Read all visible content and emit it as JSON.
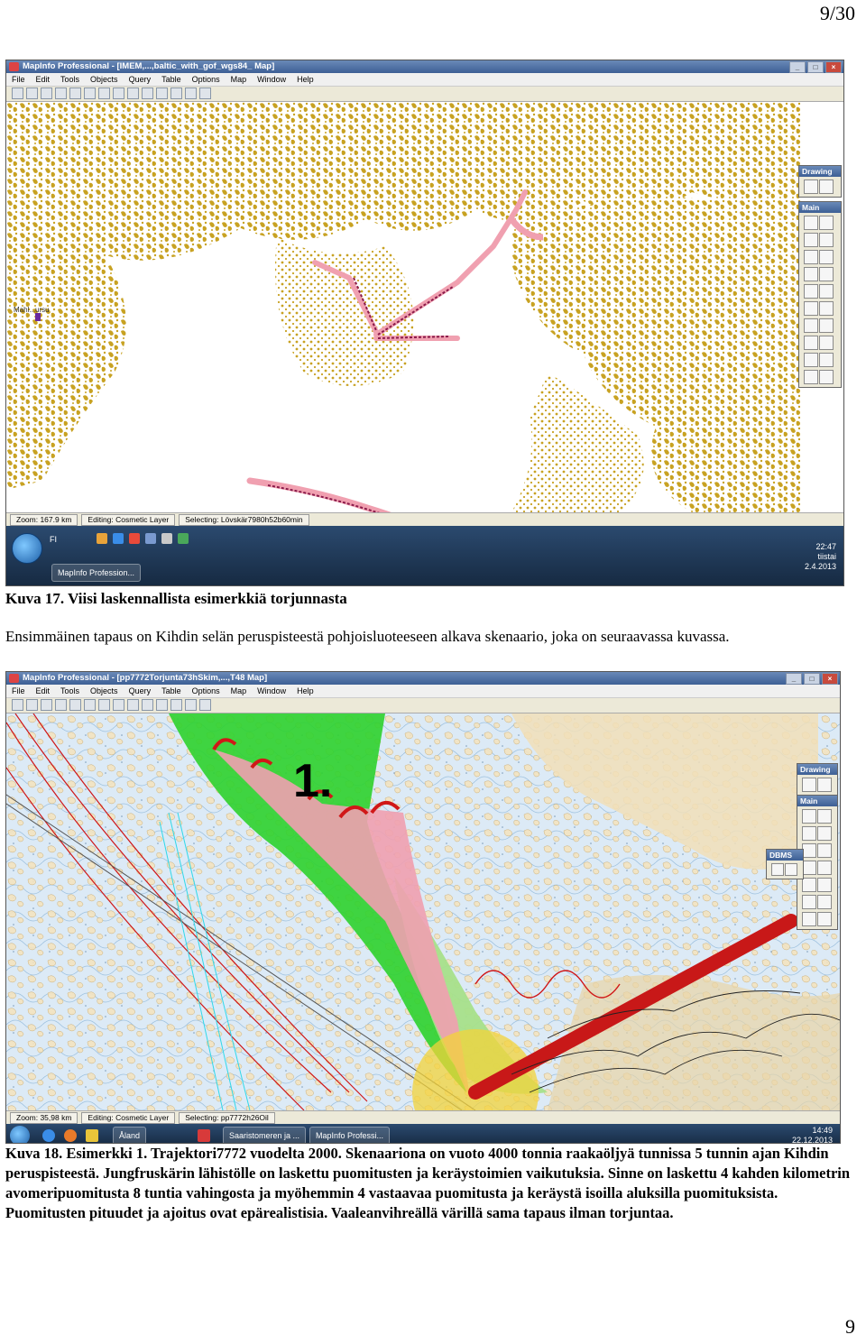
{
  "page": {
    "number_top": "9/30",
    "number_bottom": "9"
  },
  "figure1": {
    "window_title": "MapInfo Professional - [IMEM,...,baltic_with_gof_wgs84_ Map]",
    "menu": [
      "File",
      "Edit",
      "Tools",
      "Objects",
      "Query",
      "Table",
      "Options",
      "Map",
      "Window",
      "Help"
    ],
    "map_label": "Mahl...ursu",
    "panel_drawing": "Drawing",
    "panel_main": "Main",
    "status": {
      "zoom": "Zoom: 167.9 km",
      "editing": "Editing: Cosmetic Layer",
      "selecting": "Selecting: Lövskär7980h52b60min"
    },
    "taskbar": {
      "lang": "FI",
      "task": "MapInfo Profession...",
      "time": "22:47",
      "day": "tiistai",
      "date": "2.4.2013"
    },
    "caption": "Kuva 17. Viisi laskennallista esimerkkiä torjunnasta"
  },
  "paragraph1": "Ensimmäinen tapaus on Kihdin selän peruspisteestä pohjoisluoteeseen alkava skenaario, joka on seuraavassa kuvassa.",
  "figure2": {
    "window_title": "MapInfo Professional - [pp7772Torjunta73hSkim,...,T48 Map]",
    "menu": [
      "File",
      "Edit",
      "Tools",
      "Objects",
      "Query",
      "Table",
      "Options",
      "Map",
      "Window",
      "Help"
    ],
    "map_label": "1.",
    "panel_drawing": "Drawing",
    "panel_main": "Main",
    "panel_dbms": "DBMS",
    "status": {
      "zoom": "Zoom: 35,98 km",
      "editing": "Editing: Cosmetic Layer",
      "selecting": "Selecting: pp7772h26Oil"
    },
    "taskbar": {
      "task1": "Åland",
      "task2": "Saaristomeren ja ...",
      "task3": "MapInfo Professi...",
      "time": "14:49",
      "date": "22.12.2013"
    },
    "caption": "Kuva 18. Esimerkki 1. Trajektori7772 vuodelta 2000. Skenaariona on vuoto 4000 tonnia raakaöljyä tunnissa 5 tunnin ajan Kihdin peruspisteestä. Jungfruskärin lähistölle on laskettu puomitusten ja keräystoimien vaikutuksia. Sinne on laskettu 4 kahden kilometrin avomeripuomitusta 8 tuntia vahingosta ja myöhemmin 4 vastaavaa puomitusta ja keräystä isoilla aluksilla puomituksista. Puomitusten pituudet ja ajoitus ovat epärealistisia. Vaaleanvihreällä värillä sama tapaus ilman torjuntaa."
  },
  "colors": {
    "land": "#c8a222",
    "trajectory_pink": "#f0a0b0",
    "trajectory_dark": "#8a1a4a",
    "slick_green": "#2ed12e",
    "slick_light_green": "#a6e08a",
    "track_red": "#d01818",
    "cyan_tracks": "#30d8e8",
    "sea_chart": "#cfe2f2"
  }
}
